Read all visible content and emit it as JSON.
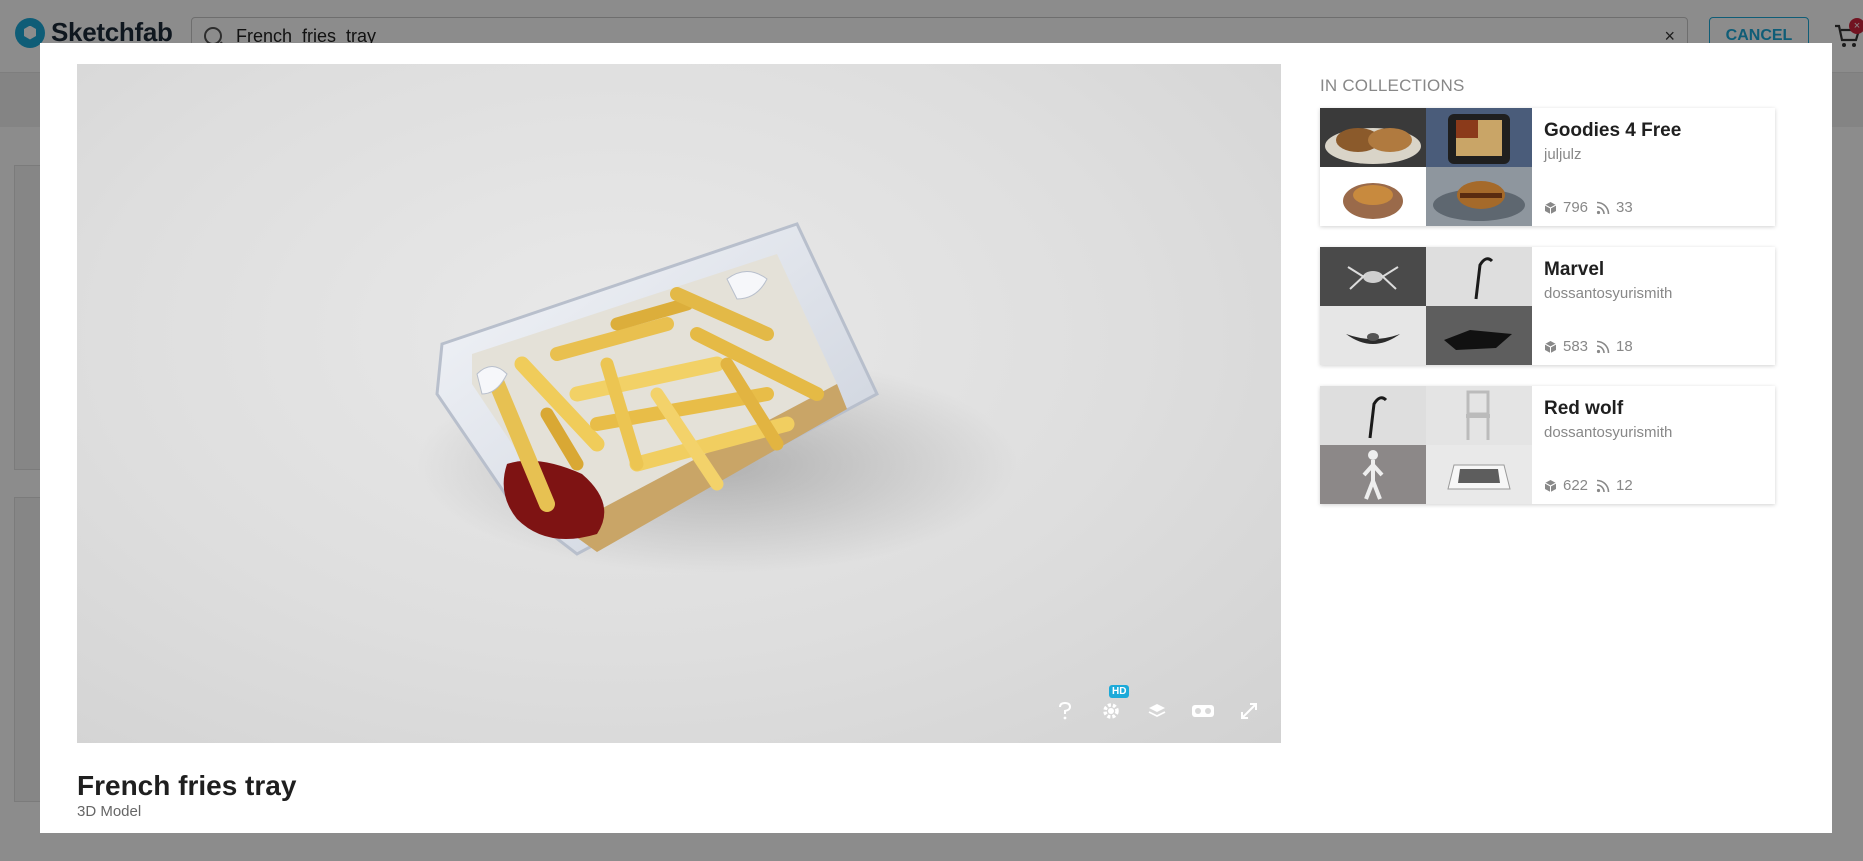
{
  "brand": {
    "name": "Sketchfab",
    "accent": "#1caad9"
  },
  "search": {
    "value": "French_fries_tray",
    "clear_glyph": "×"
  },
  "header": {
    "cancel_label": "CANCEL",
    "cart_badge": "×"
  },
  "model": {
    "title": "French fries tray",
    "type": "3D Model",
    "viewer_controls": [
      "help-icon",
      "settings-icon",
      "layers-icon",
      "vr-icon",
      "fullscreen-icon"
    ],
    "hd_badge": "HD"
  },
  "collections": {
    "heading": "IN COLLECTIONS",
    "items": [
      {
        "name": "Goodies 4 Free",
        "owner": "juljulz",
        "models": "796",
        "followers": "33"
      },
      {
        "name": "Marvel",
        "owner": "dossantosyurismith",
        "models": "583",
        "followers": "18"
      },
      {
        "name": "Red wolf",
        "owner": "dossantosyurismith",
        "models": "622",
        "followers": "12"
      }
    ]
  }
}
